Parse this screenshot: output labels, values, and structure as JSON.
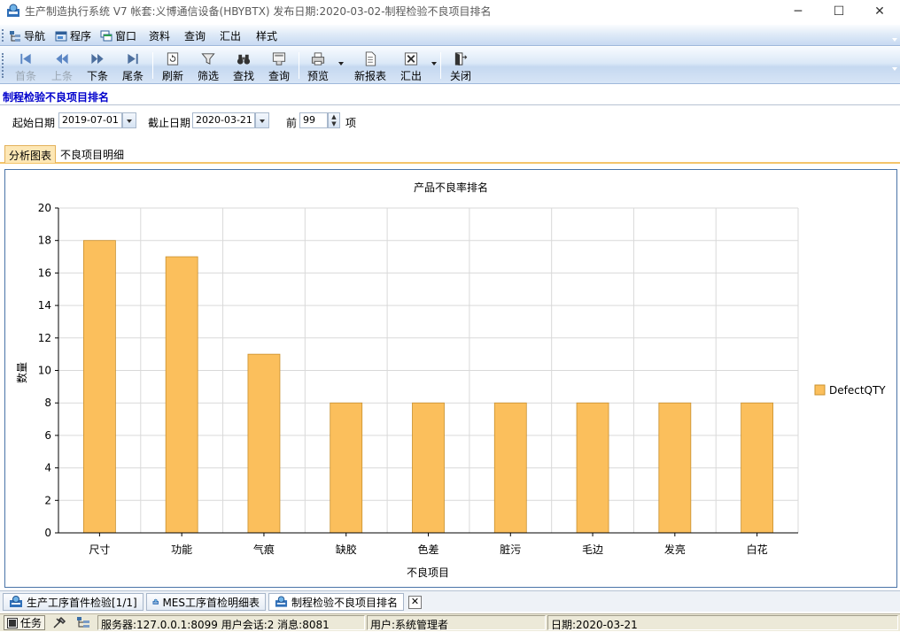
{
  "window": {
    "title": "生产制造执行系统 V7 帐套:义博通信设备(HBYBTX) 发布日期:2020-03-02-制程检验不良项目排名",
    "minimize": "─",
    "maximize": "☐",
    "close": "✕"
  },
  "menu": [
    "导航",
    "程序",
    "窗口",
    "资料",
    "查询",
    "汇出",
    "样式"
  ],
  "toolbar": {
    "first": "首条",
    "prev": "上条",
    "next": "下条",
    "last": "尾条",
    "refresh": "刷新",
    "filter": "筛选",
    "find": "查找",
    "query": "查询",
    "preview": "预览",
    "new_report": "新报表",
    "export": "汇出",
    "close": "关闭"
  },
  "page_title": "制程检验不良项目排名",
  "filters": {
    "start_label": "起始日期",
    "start_value": "2019-07-01",
    "end_label": "截止日期",
    "end_value": "2020-03-21",
    "top_label": "前",
    "top_value": "99",
    "top_suffix": "项"
  },
  "tabs": [
    "分析图表",
    "不良项目明细"
  ],
  "chart_data": {
    "type": "bar",
    "title": "产品不良率排名",
    "xlabel": "不良项目",
    "ylabel": "数量",
    "categories": [
      "尺寸",
      "功能",
      "气痕",
      "缺胶",
      "色差",
      "脏污",
      "毛边",
      "发亮",
      "白花"
    ],
    "series": [
      {
        "name": "DefectQTY",
        "values": [
          18,
          17,
          11,
          8,
          8,
          8,
          8,
          8,
          8
        ],
        "color": "#fbbf5c"
      }
    ],
    "ylim": [
      0,
      20
    ],
    "yticks": [
      0,
      2,
      4,
      6,
      8,
      10,
      12,
      14,
      16,
      18,
      20
    ],
    "grid": true,
    "legend": "right"
  },
  "doc_tabs": [
    "生产工序首件检验[1/1]",
    "MES工序首检明细表",
    "制程检验不良项目排名"
  ],
  "doc_tab_close": "✕",
  "status": {
    "task": "任务",
    "server": "服务器:127.0.0.1:8099 用户会话:2 消息:8081",
    "user": "用户:系统管理者",
    "date": "日期:2020-03-21"
  }
}
